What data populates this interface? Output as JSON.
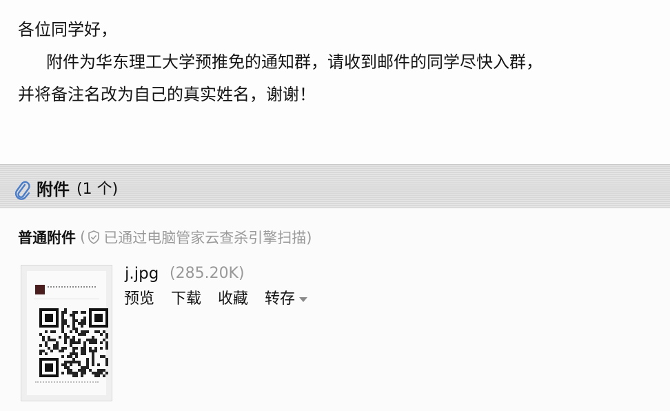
{
  "email": {
    "greeting": "各位同学好，",
    "body_line1": "附件为华东理工大学预推免的通知群，请收到邮件的同学尽快入群，",
    "body_line2": "并将备注名改为自己的真实姓名，谢谢！"
  },
  "attachments": {
    "title": "附件",
    "count": "(1 个)",
    "icon": "paperclip-icon",
    "section_label": "普通附件",
    "scan_open": "(",
    "scan_icon": "shield-check-icon",
    "scan_text": "已通过电脑管家云查杀引擎扫描)",
    "file": {
      "name": "j.jpg",
      "size": "(285.20K)",
      "thumbnail_icon": "qr-code-image-thumbnail",
      "actions": {
        "preview": "预览",
        "download": "下载",
        "favorite": "收藏",
        "save": "转存"
      }
    }
  },
  "colors": {
    "muted": "#999999",
    "text": "#111111",
    "clip": "#4a7cc8"
  }
}
